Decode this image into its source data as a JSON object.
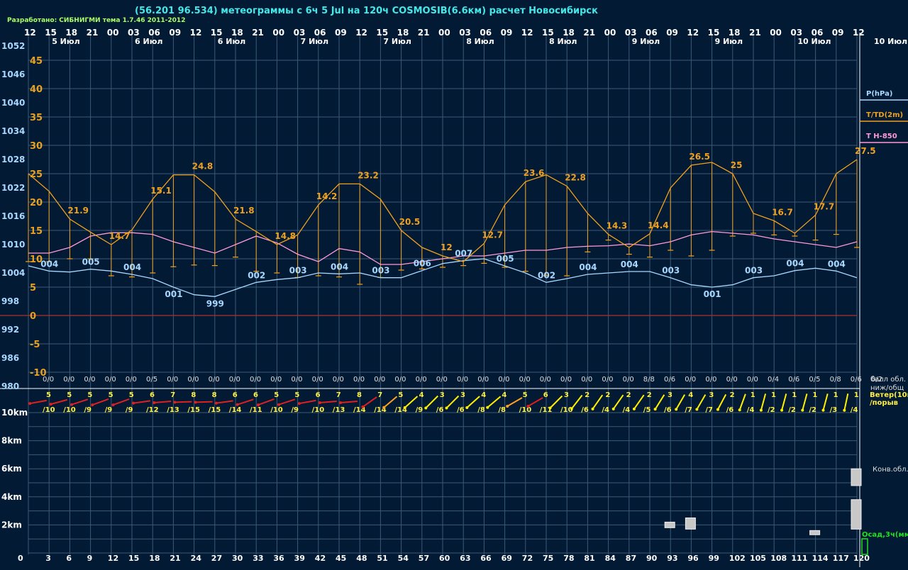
{
  "title": "(56.201 96.534) метеограммы с  6ч 5 Jul на 120ч COSMOSIB(6.6км) расчет Новосибирск",
  "credit": "Разработано: СИБНИГМИ тема 1.7.46 2011-2012",
  "colors": {
    "background": "#021a33",
    "grid": "#3a5a78",
    "pressure": "#a8d8ff",
    "temperature": "#f0a020",
    "t850": "#ff9ad8",
    "zero_line": "#b03030",
    "wind_warm": "#e02020",
    "wind_orange": "#ffa020",
    "wind_yellow": "#ffee00",
    "precip": "#20e020"
  },
  "chart_data": {
    "type": "line",
    "x_hours": [
      "12",
      "15",
      "18",
      "21",
      "00",
      "03",
      "06",
      "09",
      "12",
      "15",
      "18",
      "21",
      "00",
      "03",
      "06",
      "09",
      "12",
      "15",
      "18",
      "21",
      "00",
      "03",
      "06",
      "09",
      "12",
      "15",
      "18",
      "21",
      "00",
      "03",
      "06",
      "09",
      "12",
      "15",
      "18",
      "21",
      "00",
      "03",
      "06",
      "09",
      "12"
    ],
    "date_labels": [
      "5 Июл",
      "6 Июл",
      "6 Июл",
      "7 Июл",
      "7 Июл",
      "8 Июл",
      "8 Июл",
      "9 Июл",
      "9 Июл",
      "10 Июл"
    ],
    "date_label_right": "10 Июл",
    "pressure_axis_ticks": [
      "1052",
      "1046",
      "1040",
      "1034",
      "1028",
      "1022",
      "1016",
      "1010",
      "1004",
      "998",
      "992",
      "986",
      "980"
    ],
    "temperature_axis_ticks": [
      "45",
      "40",
      "35",
      "30",
      "25",
      "20",
      "15",
      "10",
      "5",
      "0",
      "-5",
      "-10"
    ],
    "pressure_ylim": [
      980,
      1052
    ],
    "temperature_ylim": [
      -10,
      45
    ],
    "series": [
      {
        "name": "P(hPa)",
        "values": [
          1005.5,
          1004.4,
          1004.2,
          1004.8,
          1004.4,
          1003.7,
          1002.8,
          1001.0,
          999.4,
          999.0,
          1000.5,
          1002.0,
          1002.6,
          1003.0,
          1004.0,
          1003.8,
          1004.0,
          1003.0,
          1003.0,
          1004.5,
          1006.0,
          1006.6,
          1007.0,
          1005.5,
          1004.0,
          1002.0,
          1002.8,
          1003.7,
          1004.0,
          1004.3,
          1004.3,
          1003.0,
          1001.5,
          1001.0,
          1001.5,
          1003.0,
          1003.4,
          1004.5,
          1005.0,
          1004.4,
          1003.0
        ]
      },
      {
        "name": "T/TD(2m)",
        "values": [
          25.0,
          21.9,
          17.0,
          14.7,
          12.5,
          15.1,
          20.5,
          24.8,
          24.8,
          21.8,
          17.0,
          14.8,
          12.5,
          14.2,
          19.5,
          23.2,
          23.2,
          20.5,
          15.0,
          12.0,
          10.5,
          9.5,
          12.7,
          19.5,
          23.6,
          24.8,
          22.8,
          18.0,
          14.3,
          12.0,
          14.4,
          22.5,
          26.5,
          27.0,
          25.0,
          18.0,
          16.7,
          14.5,
          17.7,
          25.0,
          27.5
        ]
      },
      {
        "name": "T H-850",
        "values": [
          11.0,
          11.0,
          12.0,
          14.0,
          14.6,
          14.6,
          14.3,
          13.0,
          12.0,
          11.0,
          12.5,
          14.0,
          12.8,
          10.8,
          9.5,
          11.8,
          11.2,
          9.0,
          9.0,
          9.5,
          10.0,
          10.5,
          10.5,
          11.0,
          11.5,
          11.5,
          12.0,
          12.2,
          12.3,
          12.6,
          12.3,
          13.0,
          14.2,
          14.8,
          14.5,
          14.2,
          13.5,
          13.0,
          12.5,
          12.0,
          13.0
        ]
      }
    ],
    "dew_point_values": [
      9.5,
      9.5,
      10.0,
      10.0,
      7.0,
      6.8,
      7.5,
      8.6,
      8.9,
      8.8,
      10.3,
      7.8,
      7.5,
      6.7,
      7.0,
      6.8,
      5.5,
      6.7,
      8.0,
      8.2,
      8.5,
      8.8,
      9.2,
      8.5,
      7.8,
      7.0,
      7.0,
      11.2,
      13.3,
      10.8,
      10.3,
      11.5,
      10.5,
      11.5,
      14.0,
      14.5,
      14.2,
      14.0,
      13.3,
      14.3,
      12.0
    ],
    "pressure_labels": [
      {
        "i": 1,
        "text": "004"
      },
      {
        "i": 3,
        "text": "005"
      },
      {
        "i": 5,
        "text": "004"
      },
      {
        "i": 7,
        "text": "001"
      },
      {
        "i": 9,
        "text": "999"
      },
      {
        "i": 11,
        "text": "002"
      },
      {
        "i": 13,
        "text": "003"
      },
      {
        "i": 15,
        "text": "004"
      },
      {
        "i": 17,
        "text": "003"
      },
      {
        "i": 19,
        "text": "006"
      },
      {
        "i": 21,
        "text": "007"
      },
      {
        "i": 23,
        "text": "005"
      },
      {
        "i": 25,
        "text": "002"
      },
      {
        "i": 27,
        "text": "004"
      },
      {
        "i": 29,
        "text": "004"
      },
      {
        "i": 31,
        "text": "003"
      },
      {
        "i": 33,
        "text": "001"
      },
      {
        "i": 35,
        "text": "003"
      },
      {
        "i": 37,
        "text": "004"
      },
      {
        "i": 39,
        "text": "004"
      }
    ],
    "temperature_labels": [
      {
        "i": 2,
        "text": "21.9"
      },
      {
        "i": 4,
        "text": "14.7"
      },
      {
        "i": 6,
        "text": "15.1"
      },
      {
        "i": 8,
        "text": "24.8"
      },
      {
        "i": 10,
        "text": "21.8"
      },
      {
        "i": 12,
        "text": "14.8"
      },
      {
        "i": 14,
        "text": "14.2"
      },
      {
        "i": 16,
        "text": "23.2"
      },
      {
        "i": 18,
        "text": "20.5"
      },
      {
        "i": 20,
        "text": "12"
      },
      {
        "i": 22,
        "text": "12.7"
      },
      {
        "i": 24,
        "text": "23.6"
      },
      {
        "i": 26,
        "text": "22.8"
      },
      {
        "i": 28,
        "text": "14.3"
      },
      {
        "i": 30,
        "text": "14.4"
      },
      {
        "i": 32,
        "text": "26.5"
      },
      {
        "i": 34,
        "text": "25"
      },
      {
        "i": 36,
        "text": "16.7"
      },
      {
        "i": 38,
        "text": "17.7"
      },
      {
        "i": 40,
        "text": "27.5"
      }
    ],
    "legend": [
      {
        "label": "P(hPa)",
        "color": "#a8d8ff"
      },
      {
        "label": "T/TD(2m)",
        "color": "#f0a020"
      },
      {
        "label": "T H-850",
        "color": "#ff9ad8"
      }
    ],
    "cloud_cover": [
      "0/0",
      "0/0",
      "0/0",
      "0/0",
      "0/0",
      "0/5",
      "0/0",
      "0/0",
      "0/0",
      "0/0",
      "0/0",
      "0/0",
      "0/0",
      "0/0",
      "0/0",
      "0/0",
      "0/0",
      "0/0",
      "0/0",
      "0/0",
      "0/0",
      "0/0",
      "0/0",
      "0/0",
      "0/0",
      "0/0",
      "0/0",
      "0/0",
      "0/0",
      "8/8",
      "0/6",
      "0/0",
      "0/0",
      "0/0",
      "0/0",
      "0/4",
      "0/6",
      "0/5",
      "0/8",
      "0/6",
      "0/2"
    ],
    "cloud_legend": [
      "балл обл.",
      "ниж/общ"
    ],
    "wind": {
      "speed": [
        "5",
        "5",
        "5",
        "5",
        "5",
        "6",
        "7",
        "8",
        "8",
        "6",
        "6",
        "5",
        "5",
        "6",
        "7",
        "8",
        "7",
        "5",
        "4",
        "3",
        "3",
        "4",
        "4",
        "5",
        "6",
        "3",
        "2",
        "2",
        "2",
        "2",
        "3",
        "4",
        "3",
        "2",
        "1",
        "1",
        "1",
        "1",
        "1",
        "1"
      ],
      "gust": [
        "/10",
        "/10",
        "/9",
        "/9",
        "/9",
        "/12",
        "/13",
        "/15",
        "/15",
        "/14",
        "/11",
        "/10",
        "/9",
        "/10",
        "/13",
        "/14",
        "/14",
        "/14",
        "/9",
        "/6",
        "/6",
        "/8",
        "/8",
        "/10",
        "/11",
        "/10",
        "/6",
        "/4",
        "/4",
        "/5",
        "/6",
        "/7",
        "/7",
        "/6",
        "/4",
        "/2",
        "/2",
        "/2",
        "/3",
        "/4"
      ],
      "direction_deg": [
        80,
        75,
        72,
        70,
        70,
        82,
        85,
        88,
        88,
        82,
        72,
        70,
        72,
        80,
        85,
        85,
        55,
        50,
        48,
        45,
        45,
        48,
        50,
        60,
        60,
        45,
        38,
        35,
        35,
        35,
        32,
        30,
        30,
        28,
        20,
        15,
        15,
        15,
        15,
        12
      ],
      "legend": [
        "Ветер(10м)",
        "/порыв"
      ]
    },
    "cloud_height_ticks": [
      "10km",
      "8km",
      "6km",
      "4km",
      "2km"
    ],
    "cloud_height_ylim": [
      0,
      10
    ],
    "convective_clouds": [
      {
        "i": 31,
        "base": 1.8,
        "top": 2.2
      },
      {
        "i": 32,
        "base": 1.7,
        "top": 2.5
      },
      {
        "i": 38,
        "base": 1.3,
        "top": 1.6
      },
      {
        "i": 40,
        "base": 1.7,
        "top": 3.8
      },
      {
        "i": 40,
        "base": 4.8,
        "top": 6.0
      }
    ],
    "convective_label": "Конв.обл.",
    "precip_label": "Осад,3ч(мм)",
    "precip_values": [],
    "step_labels": [
      "0",
      "3",
      "6",
      "9",
      "12",
      "15",
      "18",
      "21",
      "24",
      "27",
      "30",
      "33",
      "36",
      "39",
      "42",
      "45",
      "48",
      "51",
      "54",
      "57",
      "60",
      "63",
      "66",
      "69",
      "72",
      "75",
      "78",
      "81",
      "84",
      "87",
      "90",
      "93",
      "96",
      "99",
      "102",
      "105",
      "108",
      "111",
      "114",
      "117",
      "120"
    ]
  }
}
